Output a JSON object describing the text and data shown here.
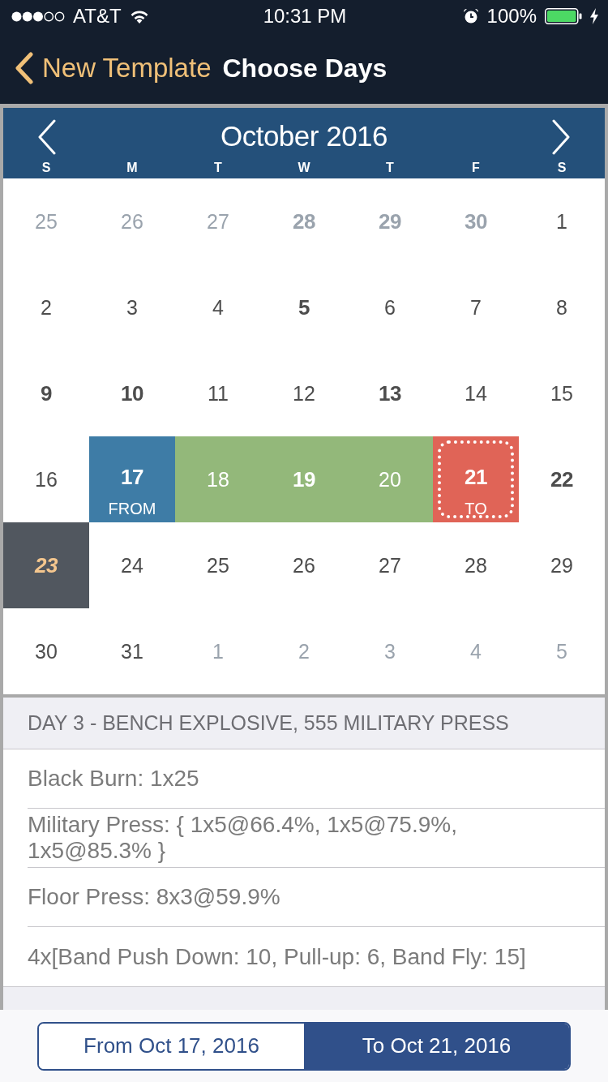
{
  "status_bar": {
    "carrier": "AT&T",
    "time": "10:31 PM",
    "battery": "100%"
  },
  "nav": {
    "back_label": "New Template",
    "title": "Choose Days"
  },
  "calendar": {
    "month": "October 2016",
    "weekdays": [
      "S",
      "M",
      "T",
      "W",
      "T",
      "F",
      "S"
    ],
    "days": [
      {
        "day": "25",
        "muted": true,
        "bold": false,
        "kind": "plain"
      },
      {
        "day": "26",
        "muted": true,
        "bold": false,
        "kind": "plain"
      },
      {
        "day": "27",
        "muted": true,
        "bold": false,
        "kind": "plain"
      },
      {
        "day": "28",
        "muted": true,
        "bold": true,
        "kind": "plain"
      },
      {
        "day": "29",
        "muted": true,
        "bold": true,
        "kind": "plain"
      },
      {
        "day": "30",
        "muted": true,
        "bold": true,
        "kind": "plain"
      },
      {
        "day": "1",
        "muted": false,
        "bold": false,
        "kind": "plain"
      },
      {
        "day": "2",
        "muted": false,
        "bold": false,
        "kind": "plain"
      },
      {
        "day": "3",
        "muted": false,
        "bold": false,
        "kind": "plain"
      },
      {
        "day": "4",
        "muted": false,
        "bold": false,
        "kind": "plain"
      },
      {
        "day": "5",
        "muted": false,
        "bold": true,
        "kind": "plain"
      },
      {
        "day": "6",
        "muted": false,
        "bold": false,
        "kind": "plain"
      },
      {
        "day": "7",
        "muted": false,
        "bold": false,
        "kind": "plain"
      },
      {
        "day": "8",
        "muted": false,
        "bold": false,
        "kind": "plain"
      },
      {
        "day": "9",
        "muted": false,
        "bold": true,
        "kind": "plain"
      },
      {
        "day": "10",
        "muted": false,
        "bold": true,
        "kind": "plain"
      },
      {
        "day": "11",
        "muted": false,
        "bold": false,
        "kind": "plain"
      },
      {
        "day": "12",
        "muted": false,
        "bold": false,
        "kind": "plain"
      },
      {
        "day": "13",
        "muted": false,
        "bold": true,
        "kind": "plain"
      },
      {
        "day": "14",
        "muted": false,
        "bold": false,
        "kind": "plain"
      },
      {
        "day": "15",
        "muted": false,
        "bold": false,
        "kind": "plain"
      },
      {
        "day": "16",
        "muted": false,
        "bold": false,
        "kind": "plain"
      },
      {
        "day": "17",
        "muted": false,
        "bold": true,
        "kind": "from",
        "label": "FROM"
      },
      {
        "day": "18",
        "muted": false,
        "bold": false,
        "kind": "between"
      },
      {
        "day": "19",
        "muted": false,
        "bold": true,
        "kind": "between"
      },
      {
        "day": "20",
        "muted": false,
        "bold": false,
        "kind": "between"
      },
      {
        "day": "21",
        "muted": false,
        "bold": true,
        "kind": "to",
        "label": "TO"
      },
      {
        "day": "22",
        "muted": false,
        "bold": true,
        "kind": "plain"
      },
      {
        "day": "23",
        "muted": false,
        "bold": true,
        "kind": "today"
      },
      {
        "day": "24",
        "muted": false,
        "bold": false,
        "kind": "plain"
      },
      {
        "day": "25",
        "muted": false,
        "bold": false,
        "kind": "plain"
      },
      {
        "day": "26",
        "muted": false,
        "bold": false,
        "kind": "plain"
      },
      {
        "day": "27",
        "muted": false,
        "bold": false,
        "kind": "plain"
      },
      {
        "day": "28",
        "muted": false,
        "bold": false,
        "kind": "plain"
      },
      {
        "day": "29",
        "muted": false,
        "bold": false,
        "kind": "plain"
      },
      {
        "day": "30",
        "muted": false,
        "bold": false,
        "kind": "plain"
      },
      {
        "day": "31",
        "muted": false,
        "bold": false,
        "kind": "plain"
      },
      {
        "day": "1",
        "muted": true,
        "bold": false,
        "kind": "plain"
      },
      {
        "day": "2",
        "muted": true,
        "bold": false,
        "kind": "plain"
      },
      {
        "day": "3",
        "muted": true,
        "bold": false,
        "kind": "plain"
      },
      {
        "day": "4",
        "muted": true,
        "bold": false,
        "kind": "plain"
      },
      {
        "day": "5",
        "muted": true,
        "bold": false,
        "kind": "plain"
      }
    ]
  },
  "workout": {
    "title": "DAY 3 - BENCH EXPLOSIVE, 555 MILITARY PRESS",
    "exercises": [
      "Black Burn: 1x25",
      "Military Press: { 1x5@66.4%, 1x5@75.9%, 1x5@85.3% }",
      "Floor Press: 8x3@59.9%",
      "4x[Band Push Down: 10, Pull-up: 6, Band Fly: 15]"
    ]
  },
  "footer": {
    "segments": [
      {
        "label": "From Oct 17, 2016",
        "selected": false
      },
      {
        "label": "To Oct 21, 2016",
        "selected": true
      }
    ]
  }
}
